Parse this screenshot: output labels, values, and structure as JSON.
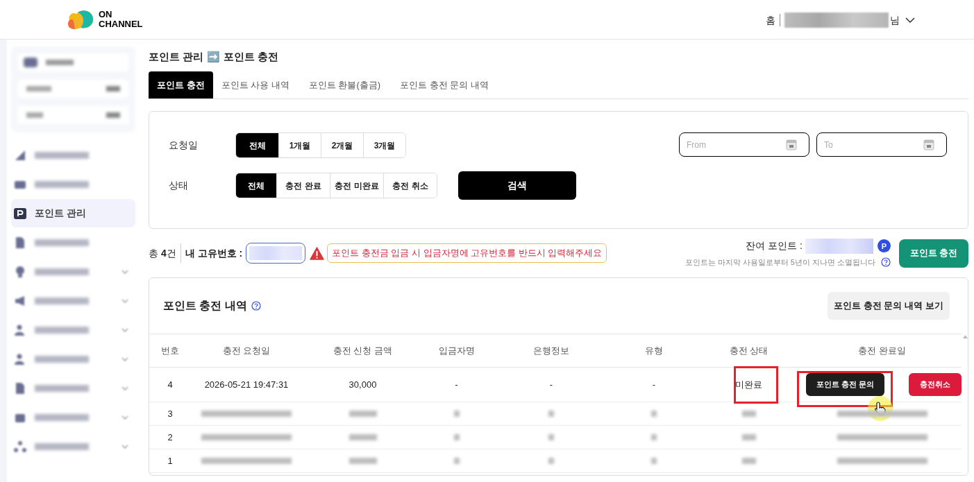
{
  "header": {
    "logo_top": "ON",
    "logo_bottom": "CHANNEL",
    "home": "홈",
    "user_suffix": "님"
  },
  "sidebar": {
    "items": [
      {
        "kind": "blurred",
        "selected": false,
        "expandable": false
      },
      {
        "kind": "blurred",
        "selected": false,
        "expandable": false
      },
      {
        "kind": "label",
        "label": "포인트 관리",
        "selected": true,
        "expandable": false
      },
      {
        "kind": "blurred",
        "selected": false,
        "expandable": false
      },
      {
        "kind": "blurred",
        "selected": false,
        "expandable": true
      },
      {
        "kind": "blurred",
        "selected": false,
        "expandable": true
      },
      {
        "kind": "blurred",
        "selected": false,
        "expandable": true
      },
      {
        "kind": "blurred",
        "selected": false,
        "expandable": true
      },
      {
        "kind": "blurred",
        "selected": false,
        "expandable": true
      },
      {
        "kind": "blurred",
        "selected": false,
        "expandable": true
      },
      {
        "kind": "blurred",
        "selected": false,
        "expandable": true
      }
    ]
  },
  "breadcrumb": {
    "parent": "포인트 관리",
    "arrow": "➡️",
    "current": "포인트 충전"
  },
  "tabs": [
    {
      "label": "포인트 충전",
      "selected": true
    },
    {
      "label": "포인트 사용 내역",
      "selected": false
    },
    {
      "label": "포인트 환불(출금)",
      "selected": false
    },
    {
      "label": "포인트 충전 문의 내역",
      "selected": false
    }
  ],
  "filters": {
    "date": {
      "label": "요청일",
      "options": [
        {
          "label": "전체",
          "selected": true
        },
        {
          "label": "1개월",
          "selected": false
        },
        {
          "label": "2개월",
          "selected": false
        },
        {
          "label": "3개월",
          "selected": false
        }
      ]
    },
    "status": {
      "label": "상태",
      "options": [
        {
          "label": "전체",
          "selected": true
        },
        {
          "label": "충전 완료",
          "selected": false
        },
        {
          "label": "충전 미완료",
          "selected": false
        },
        {
          "label": "충전 취소",
          "selected": false
        }
      ]
    },
    "search_button": "검색",
    "from": {
      "placeholder": "From"
    },
    "to": {
      "placeholder": "To"
    }
  },
  "summary": {
    "total": "총 **4**건",
    "id_label": "내 고유번호 :",
    "warning": "포인트 충전금 입금 시 입금자명에 고유번호를 반드시 입력해주세요",
    "balance_label": "잔여 포인트 :",
    "point_badge": "P",
    "expiry_note": "포인트는 마지막 사용일로부터 5년이 지나면 소멸됩니다",
    "charge_button": "포인트 충전"
  },
  "table": {
    "title": "포인트 충전 내역",
    "inquiry_button": "포인트 충전 문의 내역 보기",
    "columns": [
      "번호",
      "충전 요청일",
      "충전 신청 금액",
      "입금자명",
      "은행정보",
      "유형",
      "충전 상태",
      "충전 완료일"
    ],
    "rows": [
      {
        "number": "4",
        "blurred": false,
        "highlighted": true,
        "requested": "2026-05-21 19:47:31",
        "amount": "30,000",
        "depositor": "-",
        "bank": "-",
        "type": "-",
        "status": "미완료",
        "actions": [
          "포인트 충전 문의",
          "충전취소"
        ]
      },
      {
        "number": "3",
        "blurred": true,
        "highlighted": false
      },
      {
        "number": "2",
        "blurred": true,
        "highlighted": false
      },
      {
        "number": "1",
        "blurred": true,
        "highlighted": false
      }
    ]
  }
}
